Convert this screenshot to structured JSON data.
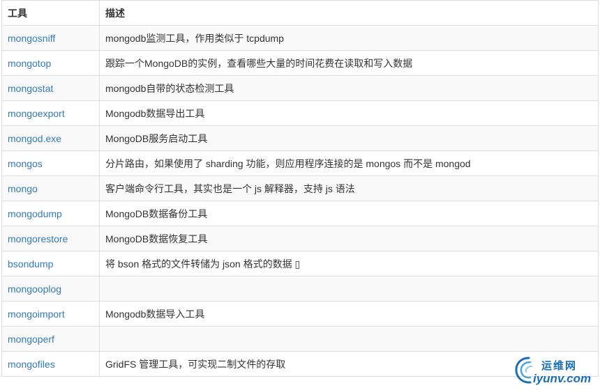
{
  "table": {
    "headers": [
      "工具",
      "描述"
    ],
    "rows": [
      {
        "tool": "mongosniff",
        "desc": "mongodb监测工具，作用类似于 tcpdump"
      },
      {
        "tool": "mongotop",
        "desc": "跟踪一个MongoDB的实例，查看哪些大量的时间花费在读取和写入数据"
      },
      {
        "tool": "mongostat",
        "desc": "mongodb自带的状态检测工具"
      },
      {
        "tool": "mongoexport",
        "desc": "Mongodb数据导出工具"
      },
      {
        "tool": "mongod.exe",
        "desc": "MongoDB服务启动工具"
      },
      {
        "tool": "mongos",
        "desc": "分片路由，如果使用了 sharding 功能，则应用程序连接的是 mongos 而不是 mongod"
      },
      {
        "tool": "mongo",
        "desc": "客户端命令行工具，其实也是一个 js 解释器，支持 js 语法"
      },
      {
        "tool": "mongodump",
        "desc": "MongoDB数据备份工具"
      },
      {
        "tool": "mongorestore",
        "desc": "MongoDB数据恢复工具"
      },
      {
        "tool": "bsondump",
        "desc": "将 bson 格式的文件转储为 json 格式的数据 ▯"
      },
      {
        "tool": "mongooplog",
        "desc": ""
      },
      {
        "tool": "mongoimport",
        "desc": "Mongodb数据导入工具"
      },
      {
        "tool": "mongoperf",
        "desc": ""
      },
      {
        "tool": "mongofiles",
        "desc": "GridFS 管理工具，可实现二制文件的存取"
      }
    ]
  },
  "watermark": {
    "name_cn": "运维网",
    "url": "iyunv.com",
    "color": "#1a6fb4"
  },
  "colors": {
    "link": "#337ab7",
    "border": "#dddddd",
    "stripe": "#f9f9f9",
    "text": "#333333"
  }
}
